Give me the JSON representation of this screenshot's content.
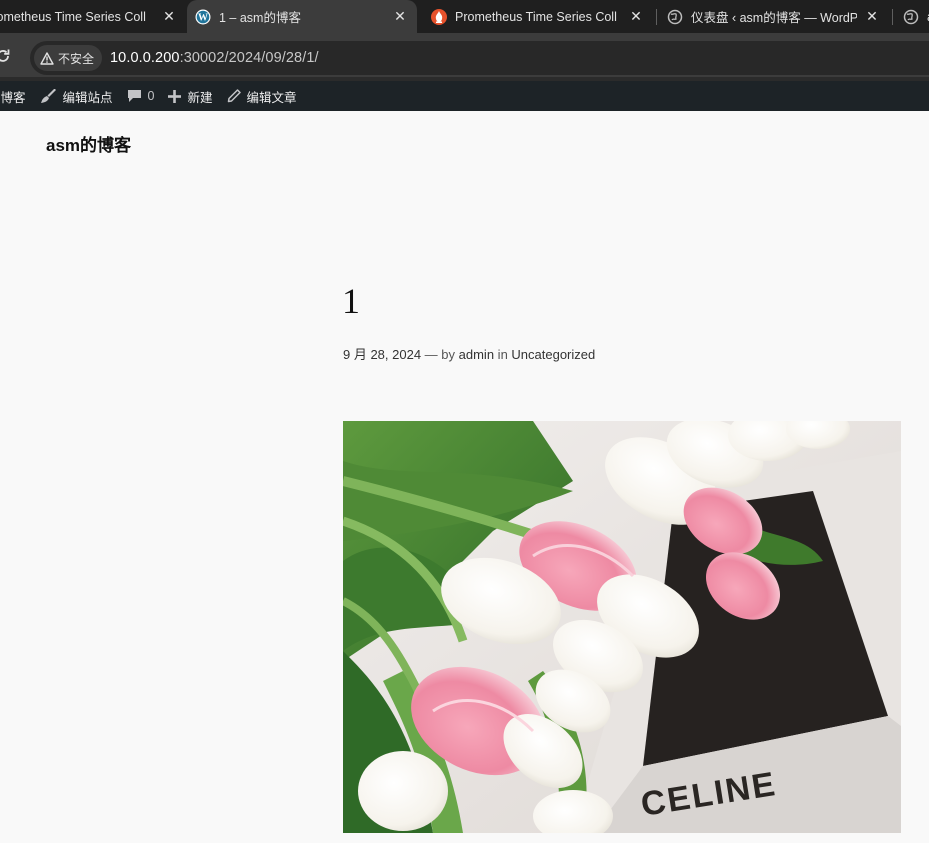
{
  "browser": {
    "tabs": [
      {
        "title": "Prometheus Time Series Coll",
        "icon": "prometheus-icon",
        "active": false
      },
      {
        "title": "1 – asm的博客",
        "icon": "wordpress-icon",
        "active": true
      },
      {
        "title": "Prometheus Time Series Coll",
        "icon": "prometheus-icon",
        "active": false
      },
      {
        "title": "仪表盘 ‹ asm的博客 — WordP",
        "icon": "globe-icon",
        "active": false
      },
      {
        "title": "a",
        "icon": "globe-icon",
        "active": false
      }
    ],
    "close_glyph": "✕",
    "security_label": "不安全",
    "url_host": "10.0.0.200",
    "url_path": ":30002/2024/09/28/1/"
  },
  "adminbar": {
    "site_name": "的博客",
    "edit_site": "编辑站点",
    "comments_count": "0",
    "new_label": "新建",
    "edit_post": "编辑文章"
  },
  "site": {
    "title": "asm的博客"
  },
  "post": {
    "title": "1",
    "date": "9 月 28, 2024",
    "by_sep": " — by ",
    "author": "admin",
    "in_sep": " in ",
    "category": "Uncategorized",
    "image_caption_text": "CELINE"
  },
  "colors": {
    "tabstrip": "#1f1f1f",
    "toolbar": "#3c3c3c",
    "omnibox": "#282828",
    "adminbar": "#1d2327",
    "page_bg": "#f9f9f9",
    "prometheus": "#e6522c",
    "wordpress": "#21759b"
  }
}
